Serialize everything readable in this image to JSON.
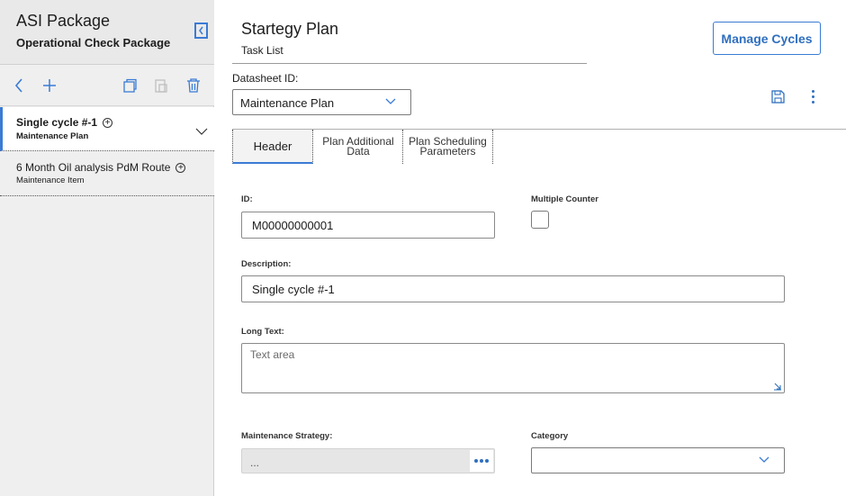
{
  "left_panel": {
    "title": "ASI Package",
    "subtitle": "Operational Check Package",
    "toolbar": {
      "back_icon": "chevron-left-icon",
      "add_icon": "plus-icon",
      "copy_icon": "copy-icon",
      "paste_icon": "paste-icon",
      "delete_icon": "trash-icon"
    },
    "items": [
      {
        "title": "Single cycle #-1",
        "subtitle": "Maintenance Plan",
        "selected": true
      },
      {
        "title": "6 Month Oil analysis PdM Route",
        "subtitle": "Maintenance Item",
        "selected": false
      }
    ]
  },
  "main": {
    "title": "Startegy Plan",
    "subtitle": "Task List",
    "manage_cycles_label": "Manage Cycles",
    "datasheet_label": "Datasheet ID:",
    "datasheet_value": "Maintenance Plan",
    "tabs": [
      {
        "label": "Header",
        "active": true
      },
      {
        "label": "Plan Additional Data",
        "active": false
      },
      {
        "label": "Plan Scheduling Parameters",
        "active": false
      }
    ],
    "form": {
      "id_label": "ID:",
      "id_value": "M00000000001",
      "multiple_counter_label": "Multiple Counter",
      "multiple_counter_checked": false,
      "description_label": "Description:",
      "description_value": "Single cycle #-1",
      "long_text_label": "Long Text:",
      "long_text_placeholder": "Text area",
      "maintenance_strategy_label": "Maintenance Strategy:",
      "maintenance_strategy_value": "...",
      "category_label": "Category",
      "category_value": ""
    }
  },
  "colors": {
    "accent": "#3a7bd5",
    "accent_text": "#2f6fbf",
    "panel_bg": "#efefef"
  }
}
